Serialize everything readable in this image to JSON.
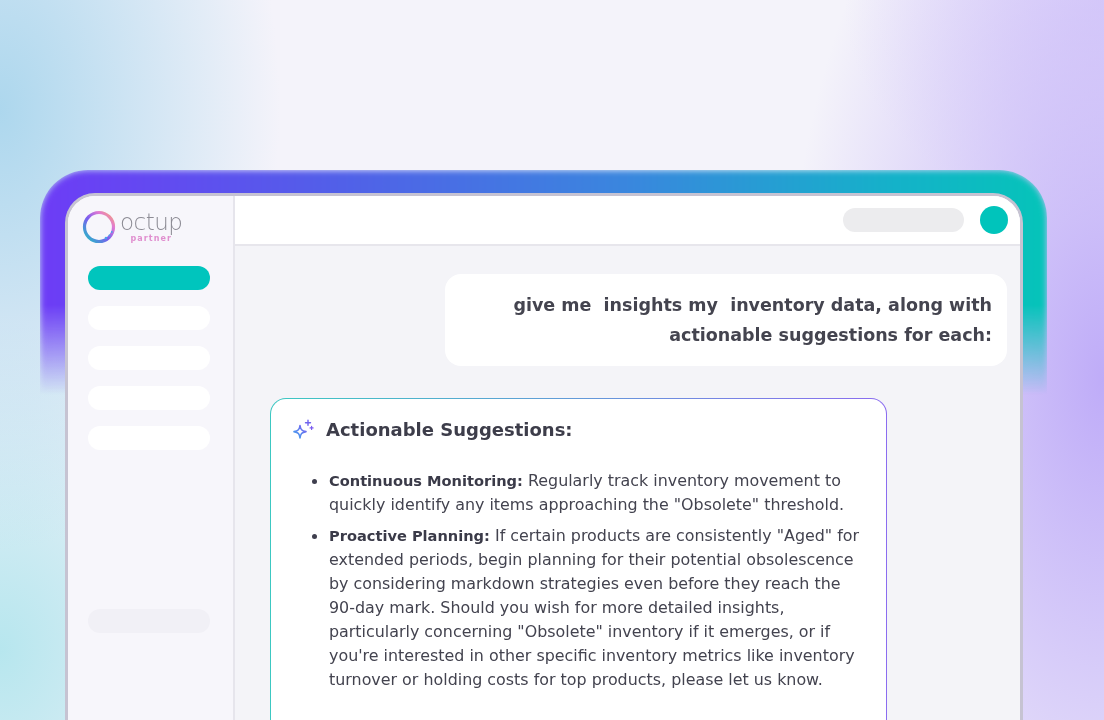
{
  "logo": {
    "name": "octup",
    "tagline": "partner"
  },
  "sidebar": {
    "items": [
      {
        "selected": true
      },
      {
        "selected": false
      },
      {
        "selected": false
      },
      {
        "selected": false
      },
      {
        "selected": false
      }
    ]
  },
  "messages": [
    {
      "kind": "user",
      "text": "give me  insights my  inventory data, along with actionable suggestions for each:"
    },
    {
      "kind": "assistant",
      "title": "Actionable Suggestions:",
      "bullets": [
        "**Continuous Monitoring:** Regularly track inventory movement to quickly identify any items approaching the \"Obsolete\" threshold.",
        "**Proactive Planning:** If certain products are consistently \"Aged\" for extended periods, begin planning for their potential obsolescence by considering markdown strategies even before they reach the 90-day mark. Should you wish for more detailed insights, particularly concerning \"Obsolete\" inventory if it emerges, or if you're interested in other specific inventory metrics like inventory turnover or holding costs for top products, please let us know."
      ]
    }
  ]
}
